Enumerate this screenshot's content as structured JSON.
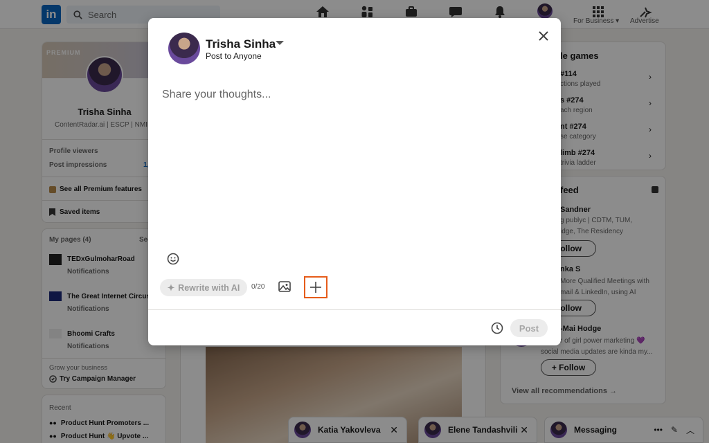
{
  "nav": {
    "logo": "in",
    "search_placeholder": "Search",
    "for_business": "For Business",
    "advertise": "Advertise"
  },
  "profile": {
    "banner_text": "PREMIUM",
    "name": "Trisha Sinha",
    "headline": "ContentRadar.ai | ESCP | NMIMS",
    "viewers_label": "Profile viewers",
    "impressions_label": "Post impressions",
    "impressions_value": "1,",
    "premium_link": "See all Premium features",
    "saved_items": "Saved items"
  },
  "pages": {
    "title": "My pages (4)",
    "see": "See",
    "items": [
      {
        "name": "TEDxGulmoharRoad",
        "sub": "Notifications"
      },
      {
        "name": "The Great Internet Circus",
        "sub": "Notifications"
      },
      {
        "name": "Bhoomi Crafts",
        "sub": "Notifications"
      }
    ]
  },
  "grow": {
    "label": "Grow your business",
    "link": "Try Campaign Manager"
  },
  "recent": {
    "title": "Recent",
    "items": [
      "Product Hunt Promoters ...",
      "Product Hunt 👋 Upvote ..."
    ]
  },
  "games": {
    "title": "le games",
    "items": [
      {
        "title": "#114",
        "sub": "ctions played"
      },
      {
        "title": "s #274",
        "sub": "ach region"
      },
      {
        "title": "nt #274",
        "sub": "se category"
      },
      {
        "title": "limb #274",
        "sub": "trivia ladder"
      }
    ]
  },
  "feed": {
    "title": "feed",
    "people": [
      {
        "name": "Sandner",
        "line1": "g publyc | CDTM, TUM,",
        "line2": "idge, The Residency",
        "follow": "Follow"
      },
      {
        "name": "nka S",
        "line1": "More Qualified Meetings with",
        "line2": "mail & LinkedIn, using AI",
        "follow": "Follow"
      },
      {
        "name": "-Mai Hodge",
        "line1": "r of girl power marketing 💜",
        "line2": "social media updates are kinda my...",
        "follow": "+ Follow"
      }
    ],
    "view_all": "View all recommendations →"
  },
  "modal": {
    "user_name": "Trisha Sinha",
    "audience": "Post to Anyone",
    "placeholder": "Share your thoughts...",
    "rewrite_label": "Rewrite with AI",
    "counter": "0/20",
    "post_label": "Post"
  },
  "chats": [
    {
      "name": "Katia Yakovleva"
    },
    {
      "name": "Elene Tandashvili"
    },
    {
      "name": "Messaging"
    }
  ],
  "colors": {
    "brand": "#0a66c2",
    "highlight": "#e65c1a"
  }
}
